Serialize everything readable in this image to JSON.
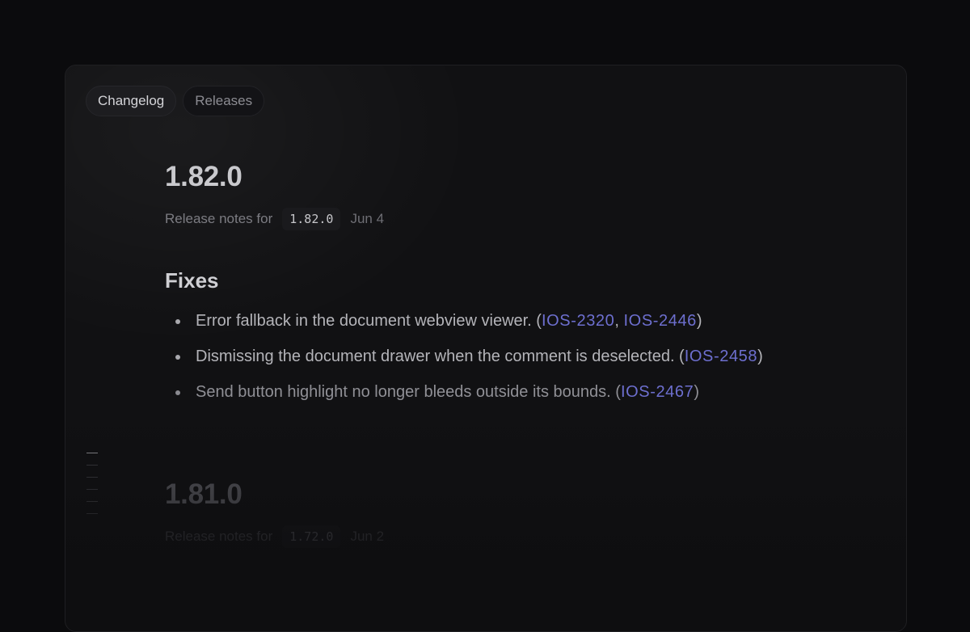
{
  "tabs": [
    {
      "label": "Changelog",
      "active": true
    },
    {
      "label": "Releases",
      "active": false
    }
  ],
  "current_release": {
    "version": "1.82.0",
    "meta_prefix": "Release notes for",
    "tag": "1.82.0",
    "date": "Jun 4",
    "section_title": "Fixes",
    "fixes": [
      {
        "text": "Error fallback in the document webview viewer. (",
        "links": [
          "IOS-2320",
          "IOS-2446"
        ],
        "separator": ", ",
        "suffix": ")"
      },
      {
        "text": "Dismissing the document drawer when the comment is deselected. (",
        "links": [
          "IOS-2458"
        ],
        "suffix": ")"
      },
      {
        "text": "Send button highlight no longer bleeds outside its bounds. (",
        "links": [
          "IOS-2467"
        ],
        "suffix": ")"
      }
    ]
  },
  "previous_release": {
    "version": "1.81.0",
    "meta_prefix": "Release notes for",
    "tag": "1.72.0",
    "date": "Jun 2"
  },
  "colors": {
    "background": "#0b0b0d",
    "panel": "#111113",
    "link": "#6d6fcf",
    "text_primary": "#c9c9cd"
  }
}
